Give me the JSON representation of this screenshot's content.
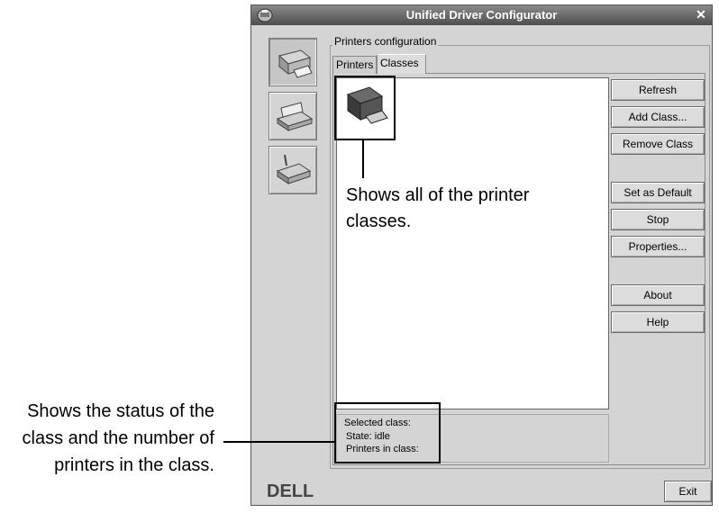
{
  "window": {
    "title": "Unified Driver Configurator",
    "close_glyph": "✕"
  },
  "sidebar": {
    "items": [
      {
        "name": "printers-configuration",
        "icon": "printer-icon",
        "active": true
      },
      {
        "name": "scanners-configuration",
        "icon": "scanner-icon",
        "active": false
      },
      {
        "name": "ports-configuration",
        "icon": "port-icon",
        "active": false
      }
    ]
  },
  "group": {
    "label": "Printers configuration"
  },
  "tabs": [
    {
      "label": "Printers",
      "selected": false
    },
    {
      "label": "Classes",
      "selected": true
    }
  ],
  "buttons": {
    "refresh": "Refresh",
    "add_class": "Add Class...",
    "remove_class": "Remove Class",
    "set_default": "Set as Default",
    "stop": "Stop",
    "properties": "Properties...",
    "about": "About",
    "help": "Help",
    "exit": "Exit"
  },
  "status": {
    "selected_class": "Selected class:",
    "state": "State: idle",
    "printers_in_class": "Printers in class:"
  },
  "brand": {
    "logo_text": "DELL"
  },
  "annotations": {
    "list_note_line1": "Shows all of the printer",
    "list_note_line2": "classes.",
    "status_note_line1": "Shows the status of the",
    "status_note_line2": "class and the number of",
    "status_note_line3": "printers in the class."
  },
  "colors": {
    "window_bg": "#d4d4d4",
    "titlebar": "#5a5a5a",
    "list_bg": "#ffffff"
  }
}
